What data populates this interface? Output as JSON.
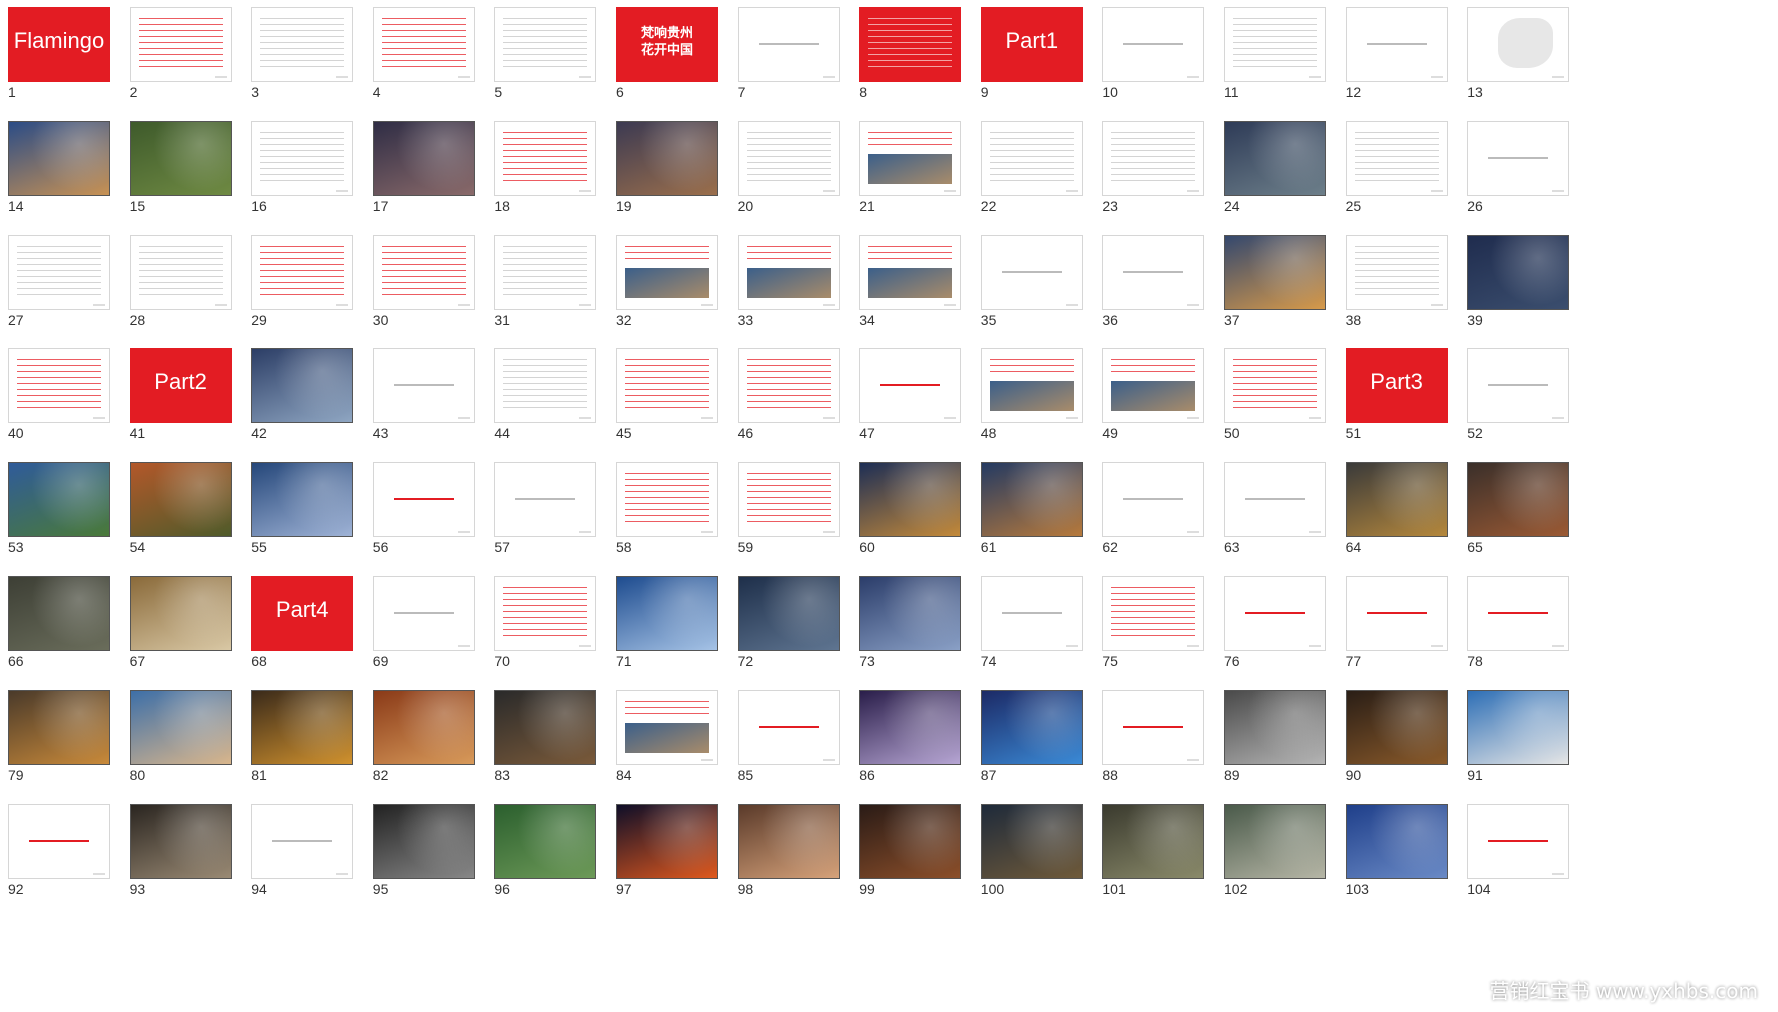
{
  "watermark": "营销红宝书 www.yxhbs.com",
  "slides": [
    {
      "n": "1",
      "kind": "red",
      "title": "Flamingo"
    },
    {
      "n": "2",
      "kind": "white-red"
    },
    {
      "n": "3",
      "kind": "white"
    },
    {
      "n": "4",
      "kind": "white-red"
    },
    {
      "n": "5",
      "kind": "white"
    },
    {
      "n": "6",
      "kind": "red",
      "title": "梵响贵州\n花开中国"
    },
    {
      "n": "7",
      "kind": "white-center"
    },
    {
      "n": "8",
      "kind": "red-lines"
    },
    {
      "n": "9",
      "kind": "red",
      "title": "Part1"
    },
    {
      "n": "10",
      "kind": "white-center"
    },
    {
      "n": "11",
      "kind": "white"
    },
    {
      "n": "12",
      "kind": "white-center"
    },
    {
      "n": "13",
      "kind": "white-map"
    },
    {
      "n": "14",
      "kind": "photo",
      "c1": "#2b4c86",
      "c2": "#c89254"
    },
    {
      "n": "15",
      "kind": "photo",
      "c1": "#3e5a2b",
      "c2": "#6f8a43"
    },
    {
      "n": "16",
      "kind": "white"
    },
    {
      "n": "17",
      "kind": "photo",
      "c1": "#2f2d45",
      "c2": "#8a6a6a"
    },
    {
      "n": "18",
      "kind": "white-red"
    },
    {
      "n": "19",
      "kind": "photo",
      "c1": "#3c3a52",
      "c2": "#9b6f4c"
    },
    {
      "n": "20",
      "kind": "white"
    },
    {
      "n": "21",
      "kind": "white-photo"
    },
    {
      "n": "22",
      "kind": "white"
    },
    {
      "n": "23",
      "kind": "white"
    },
    {
      "n": "24",
      "kind": "photo",
      "c1": "#2e3b57",
      "c2": "#6d7f8a"
    },
    {
      "n": "25",
      "kind": "white"
    },
    {
      "n": "26",
      "kind": "white-center"
    },
    {
      "n": "27",
      "kind": "white"
    },
    {
      "n": "28",
      "kind": "white"
    },
    {
      "n": "29",
      "kind": "white-red"
    },
    {
      "n": "30",
      "kind": "white-red"
    },
    {
      "n": "31",
      "kind": "white"
    },
    {
      "n": "32",
      "kind": "white-photo"
    },
    {
      "n": "33",
      "kind": "white-photo"
    },
    {
      "n": "34",
      "kind": "white-photo"
    },
    {
      "n": "35",
      "kind": "white-center"
    },
    {
      "n": "36",
      "kind": "white-center"
    },
    {
      "n": "37",
      "kind": "photo",
      "c1": "#34486e",
      "c2": "#d79a4a"
    },
    {
      "n": "38",
      "kind": "white"
    },
    {
      "n": "39",
      "kind": "photo",
      "c1": "#1f2c4e",
      "c2": "#3b4e6e"
    },
    {
      "n": "40",
      "kind": "white-red"
    },
    {
      "n": "41",
      "kind": "red",
      "title": "Part2"
    },
    {
      "n": "42",
      "kind": "photo",
      "c1": "#2c3e66",
      "c2": "#8fa6c2"
    },
    {
      "n": "43",
      "kind": "white-center"
    },
    {
      "n": "44",
      "kind": "white"
    },
    {
      "n": "45",
      "kind": "white-red"
    },
    {
      "n": "46",
      "kind": "white-red"
    },
    {
      "n": "47",
      "kind": "white-center-red"
    },
    {
      "n": "48",
      "kind": "white-photo"
    },
    {
      "n": "49",
      "kind": "white-photo"
    },
    {
      "n": "50",
      "kind": "white-red"
    },
    {
      "n": "51",
      "kind": "red",
      "title": "Part3"
    },
    {
      "n": "52",
      "kind": "white-center"
    },
    {
      "n": "53",
      "kind": "photo",
      "c1": "#2f5b9a",
      "c2": "#4a7a39"
    },
    {
      "n": "54",
      "kind": "photo",
      "c1": "#b3582a",
      "c2": "#4f5b2a"
    },
    {
      "n": "55",
      "kind": "photo",
      "c1": "#25477a",
      "c2": "#9fb3d6"
    },
    {
      "n": "56",
      "kind": "white-center-red"
    },
    {
      "n": "57",
      "kind": "white-center"
    },
    {
      "n": "58",
      "kind": "white-red"
    },
    {
      "n": "59",
      "kind": "white-red"
    },
    {
      "n": "60",
      "kind": "photo",
      "c1": "#1d2e55",
      "c2": "#c48a3a"
    },
    {
      "n": "61",
      "kind": "photo",
      "c1": "#243a62",
      "c2": "#b77a3c"
    },
    {
      "n": "62",
      "kind": "white-center"
    },
    {
      "n": "63",
      "kind": "white-center"
    },
    {
      "n": "64",
      "kind": "photo",
      "c1": "#3a3a3a",
      "c2": "#b5883c"
    },
    {
      "n": "65",
      "kind": "photo",
      "c1": "#3a2f2a",
      "c2": "#9b5a34"
    },
    {
      "n": "66",
      "kind": "photo",
      "c1": "#3d3f35",
      "c2": "#6a6d5b"
    },
    {
      "n": "67",
      "kind": "photo",
      "c1": "#8a6a3a",
      "c2": "#d9c8a5"
    },
    {
      "n": "68",
      "kind": "red",
      "title": "Part4"
    },
    {
      "n": "69",
      "kind": "white-center"
    },
    {
      "n": "70",
      "kind": "white-red"
    },
    {
      "n": "71",
      "kind": "photo",
      "c1": "#1e4c8f",
      "c2": "#a6c3e6"
    },
    {
      "n": "72",
      "kind": "photo",
      "c1": "#1e2f4a",
      "c2": "#5f7591"
    },
    {
      "n": "73",
      "kind": "photo",
      "c1": "#2b3d6a",
      "c2": "#8aa0c6"
    },
    {
      "n": "74",
      "kind": "white-center"
    },
    {
      "n": "75",
      "kind": "white-red"
    },
    {
      "n": "76",
      "kind": "white-center-red"
    },
    {
      "n": "77",
      "kind": "white-center-red"
    },
    {
      "n": "78",
      "kind": "white-center-red"
    },
    {
      "n": "79",
      "kind": "photo",
      "c1": "#4a3a2a",
      "c2": "#c98a3a"
    },
    {
      "n": "80",
      "kind": "photo",
      "c1": "#3d6fa8",
      "c2": "#d9b68c"
    },
    {
      "n": "81",
      "kind": "photo",
      "c1": "#3a2a1a",
      "c2": "#d1922e"
    },
    {
      "n": "82",
      "kind": "photo",
      "c1": "#8a3a18",
      "c2": "#d89a5a"
    },
    {
      "n": "83",
      "kind": "photo",
      "c1": "#2a2a2a",
      "c2": "#7a5a3a"
    },
    {
      "n": "84",
      "kind": "white-photo"
    },
    {
      "n": "85",
      "kind": "white-center-red"
    },
    {
      "n": "86",
      "kind": "photo",
      "c1": "#2a1e4a",
      "c2": "#b7a6d4"
    },
    {
      "n": "87",
      "kind": "photo",
      "c1": "#1c2a66",
      "c2": "#3b8ad6"
    },
    {
      "n": "88",
      "kind": "white-center-red"
    },
    {
      "n": "89",
      "kind": "photo",
      "c1": "#4a4a4a",
      "c2": "#b5b5b5"
    },
    {
      "n": "90",
      "kind": "photo",
      "c1": "#2a1e16",
      "c2": "#8a5a2a"
    },
    {
      "n": "91",
      "kind": "photo",
      "c1": "#2e6fb6",
      "c2": "#e6e6e6"
    },
    {
      "n": "92",
      "kind": "white-center-red"
    },
    {
      "n": "93",
      "kind": "photo",
      "c1": "#2a2520",
      "c2": "#9a8a74"
    },
    {
      "n": "94",
      "kind": "white-center"
    },
    {
      "n": "95",
      "kind": "photo",
      "c1": "#222222",
      "c2": "#888888"
    },
    {
      "n": "96",
      "kind": "photo",
      "c1": "#2b5f2e",
      "c2": "#6d9a58"
    },
    {
      "n": "97",
      "kind": "photo",
      "c1": "#0e0e28",
      "c2": "#e0591e"
    },
    {
      "n": "98",
      "kind": "photo",
      "c1": "#5a3a2a",
      "c2": "#d6a27a"
    },
    {
      "n": "99",
      "kind": "photo",
      "c1": "#2a1b16",
      "c2": "#8c4f2a"
    },
    {
      "n": "100",
      "kind": "photo",
      "c1": "#1e2a3a",
      "c2": "#6f5a3a"
    },
    {
      "n": "101",
      "kind": "photo",
      "c1": "#3a3a2e",
      "c2": "#8a8a6a"
    },
    {
      "n": "102",
      "kind": "photo",
      "c1": "#4a5a4a",
      "c2": "#b6b6a6"
    },
    {
      "n": "103",
      "kind": "photo",
      "c1": "#1f3f8a",
      "c2": "#6a8ac6"
    },
    {
      "n": "104",
      "kind": "white-center-red"
    }
  ]
}
